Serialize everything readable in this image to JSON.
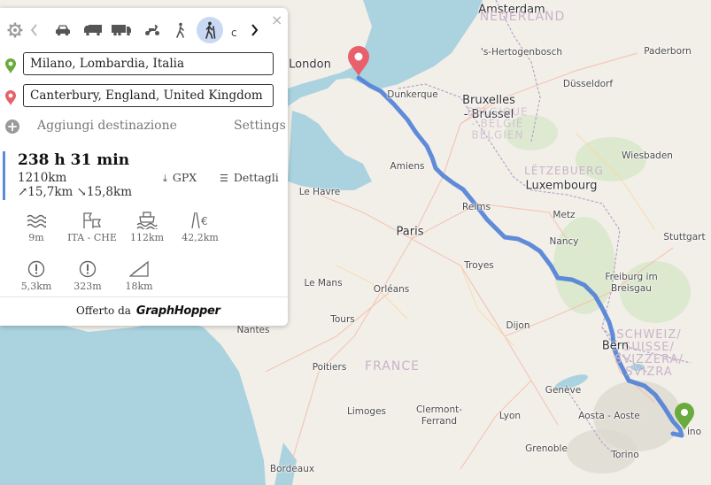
{
  "map": {
    "labels": [
      {
        "id": "amsterdam",
        "text": "Amsterdam",
        "cls": "big"
      },
      {
        "id": "nederland",
        "text": "NEDERLAND",
        "cls": "country"
      },
      {
        "id": "den-bosch",
        "text": "'s-Hertogenbosch",
        "cls": ""
      },
      {
        "id": "paderborn",
        "text": "Paderborn",
        "cls": ""
      },
      {
        "id": "london",
        "text": "London",
        "cls": "big"
      },
      {
        "id": "dunkerque",
        "text": "Dunkerque",
        "cls": ""
      },
      {
        "id": "bruxelles",
        "text": "Bruxelles\n- Brussel",
        "cls": "big"
      },
      {
        "id": "belgique",
        "text": "BELGIQUE\n- BELGIË\nBELGIEN",
        "cls": "country"
      },
      {
        "id": "dusseldorf",
        "text": "Düsseldorf",
        "cls": ""
      },
      {
        "id": "amiens",
        "text": "Amiens",
        "cls": ""
      },
      {
        "id": "wiesbaden",
        "text": "Wiesbaden",
        "cls": ""
      },
      {
        "id": "letzebuerg",
        "text": "LËTZEBUERG",
        "cls": "country"
      },
      {
        "id": "luxembourg",
        "text": "Luxembourg",
        "cls": "big"
      },
      {
        "id": "le-havre",
        "text": "Le Havre",
        "cls": ""
      },
      {
        "id": "reims",
        "text": "Reims",
        "cls": ""
      },
      {
        "id": "metz",
        "text": "Metz",
        "cls": ""
      },
      {
        "id": "paris",
        "text": "Paris",
        "cls": "big"
      },
      {
        "id": "stuttgart",
        "text": "Stuttgart",
        "cls": ""
      },
      {
        "id": "nancy",
        "text": "Nancy",
        "cls": ""
      },
      {
        "id": "troyes",
        "text": "Troyes",
        "cls": ""
      },
      {
        "id": "le-mans",
        "text": "Le Mans",
        "cls": ""
      },
      {
        "id": "freiburg",
        "text": "Freiburg im\nBreisgau",
        "cls": ""
      },
      {
        "id": "orleans",
        "text": "Orléans",
        "cls": ""
      },
      {
        "id": "nantes",
        "text": "Nantes",
        "cls": ""
      },
      {
        "id": "tours",
        "text": "Tours",
        "cls": ""
      },
      {
        "id": "dijon",
        "text": "Dijon",
        "cls": ""
      },
      {
        "id": "schweiz",
        "text": "SCHWEIZ/\nSUISSE/\nSVIZZERA/\nSVIZRA",
        "cls": "country"
      },
      {
        "id": "bern",
        "text": "Bern",
        "cls": "big"
      },
      {
        "id": "poitiers",
        "text": "Poitiers",
        "cls": ""
      },
      {
        "id": "france",
        "text": "FRANCE",
        "cls": "country"
      },
      {
        "id": "geneve",
        "text": "Genève",
        "cls": ""
      },
      {
        "id": "limoges",
        "text": "Limoges",
        "cls": ""
      },
      {
        "id": "clermont",
        "text": "Clermont-\nFerrand",
        "cls": ""
      },
      {
        "id": "lyon",
        "text": "Lyon",
        "cls": ""
      },
      {
        "id": "aosta",
        "text": "Aosta - Aoste",
        "cls": ""
      },
      {
        "id": "grenoble",
        "text": "Grenoble",
        "cls": ""
      },
      {
        "id": "torino",
        "text": "Torino",
        "cls": ""
      },
      {
        "id": "bordeaux",
        "text": "Bordeaux",
        "cls": ""
      },
      {
        "id": "milano-frag",
        "text": "ino",
        "cls": ""
      }
    ]
  },
  "panel": {
    "close_glyph": "×",
    "mode_more": "c",
    "start_value": "Milano, Lombardia, Italia",
    "end_value": "Canterbury, England, United Kingdom",
    "add_destination": "Aggiungi destinazione",
    "settings": "Settings",
    "plus_glyph": "+",
    "summary": {
      "time": "238 h 31 min",
      "distance": "1210km",
      "elevation": "↗15,7km ↘15,8km",
      "gpx": "GPX",
      "details": "Dettagli"
    },
    "stats": [
      {
        "icon": "waves-icon",
        "value": "9m"
      },
      {
        "icon": "border-flags-icon",
        "value": "ITA - CHE"
      },
      {
        "icon": "ferry-icon",
        "value": "112km"
      },
      {
        "icon": "toll-icon",
        "value": "42,2km"
      },
      {
        "icon": "warning-icon",
        "value": "5,3km"
      },
      {
        "icon": "warning-icon",
        "value": "323m"
      },
      {
        "icon": "steep-icon",
        "value": "18km"
      }
    ],
    "offered_by": "Offerto da",
    "brand": "GraphHopper"
  },
  "colors": {
    "route": "#4f7fd6",
    "start_pin": "#6aab3e",
    "end_pin": "#e8606b",
    "selected_mode": "#c9d9f3"
  }
}
